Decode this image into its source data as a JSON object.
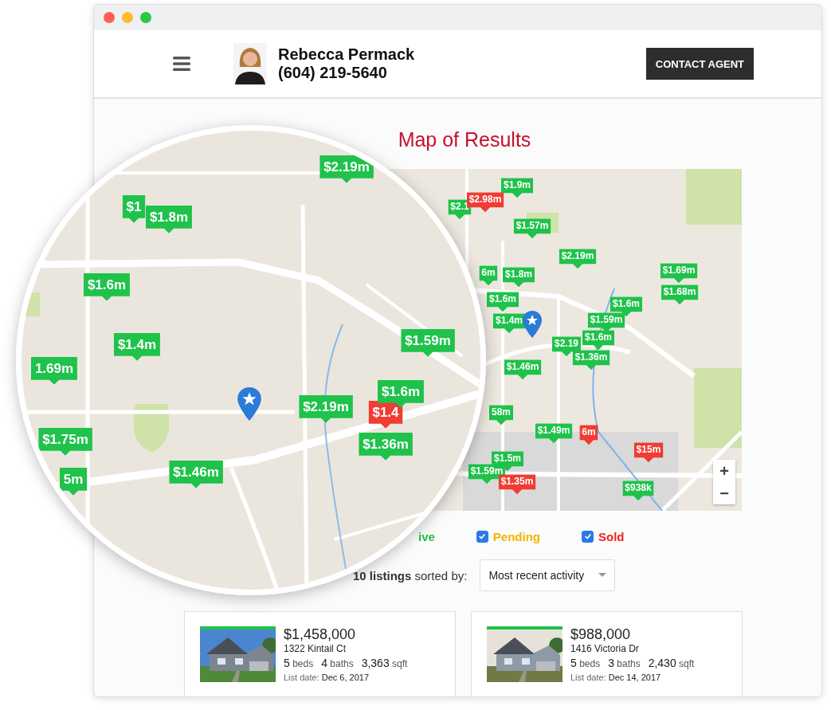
{
  "header": {
    "agent_name": "Rebecca Permack",
    "agent_phone": "(604) 219-5640",
    "contact_button": "CONTACT AGENT"
  },
  "title": "Map of Results",
  "map": {
    "zoom_in": "+",
    "zoom_out": "−",
    "markers": [
      {
        "text": "$1.9m",
        "color": "#1fc24a"
      },
      {
        "text": "$2.1",
        "color": "#1fc24a"
      },
      {
        "text": "$2.98m",
        "color": "#f03c32"
      },
      {
        "text": "$1.57m",
        "color": "#1fc24a"
      },
      {
        "text": "$2.19m",
        "color": "#1fc24a"
      },
      {
        "text": "6m",
        "color": "#1fc24a"
      },
      {
        "text": "$1.8m",
        "color": "#1fc24a"
      },
      {
        "text": "$1.69m",
        "color": "#1fc24a"
      },
      {
        "text": "$1.68m",
        "color": "#1fc24a"
      },
      {
        "text": "$1.6m",
        "color": "#1fc24a"
      },
      {
        "text": "$1.6m",
        "color": "#1fc24a"
      },
      {
        "text": "$1.4m",
        "color": "#1fc24a"
      },
      {
        "text": "$1.59m",
        "color": "#1fc24a"
      },
      {
        "text": "$2.19",
        "color": "#1fc24a"
      },
      {
        "text": "$1.6m",
        "color": "#1fc24a"
      },
      {
        "text": "$1.36m",
        "color": "#1fc24a"
      },
      {
        "text": "$1.46m",
        "color": "#1fc24a"
      },
      {
        "text": "58m",
        "color": "#1fc24a"
      },
      {
        "text": "6m",
        "color": "#f03c32"
      },
      {
        "text": "$1.49m",
        "color": "#1fc24a"
      },
      {
        "text": "$1.5m",
        "color": "#1fc24a"
      },
      {
        "text": "$1.59m",
        "color": "#1fc24a"
      },
      {
        "text": "$1.35m",
        "color": "#f03c32"
      },
      {
        "text": "$15m",
        "color": "#f03c32"
      },
      {
        "text": "$938k",
        "color": "#1fc24a"
      }
    ]
  },
  "magnifier": {
    "markers": [
      {
        "text": "$2.19m",
        "color": "#1fc24a"
      },
      {
        "text": "$1",
        "color": "#1fc24a"
      },
      {
        "text": "$1.8m",
        "color": "#1fc24a"
      },
      {
        "text": "$1.6m",
        "color": "#1fc24a"
      },
      {
        "text": "$1.4m",
        "color": "#1fc24a"
      },
      {
        "text": "1.69m",
        "color": "#1fc24a"
      },
      {
        "text": "$1.59m",
        "color": "#1fc24a"
      },
      {
        "text": "$2.19m",
        "color": "#1fc24a"
      },
      {
        "text": "$1.4",
        "color": "#f03c32"
      },
      {
        "text": "$1.6m",
        "color": "#1fc24a"
      },
      {
        "text": "$1.36m",
        "color": "#1fc24a"
      },
      {
        "text": "$1.75m",
        "color": "#1fc24a"
      },
      {
        "text": "5m",
        "color": "#1fc24a"
      },
      {
        "text": "$1.46m",
        "color": "#1fc24a"
      }
    ]
  },
  "filters": [
    {
      "label": "ive",
      "color": "#1fc24a"
    },
    {
      "label": "Pending",
      "color": "#f5b400",
      "checked": true
    },
    {
      "label": "Sold",
      "color": "#f0241c",
      "checked": true
    }
  ],
  "sort": {
    "summary": "**10 listings** sorted by:",
    "value": "Most recent activity"
  },
  "listings": [
    {
      "color": "#1fc24a",
      "price": "$1,458,000",
      "address": "1322 Kintail Ct",
      "beds": "5",
      "beds_label": "beds",
      "baths": "4",
      "baths_label": "baths",
      "sqft": "3,363",
      "sqft_label": "sqft",
      "date_label": "List date:",
      "date": "Dec 6, 2017"
    },
    {
      "color": "#1fc24a",
      "price": "$988,000",
      "address": "1416 Victoria Dr",
      "beds": "5",
      "beds_label": "beds",
      "baths": "3",
      "baths_label": "baths",
      "sqft": "2,430",
      "sqft_label": "sqft",
      "date_label": "List date:",
      "date": "Dec 14, 2017"
    }
  ]
}
